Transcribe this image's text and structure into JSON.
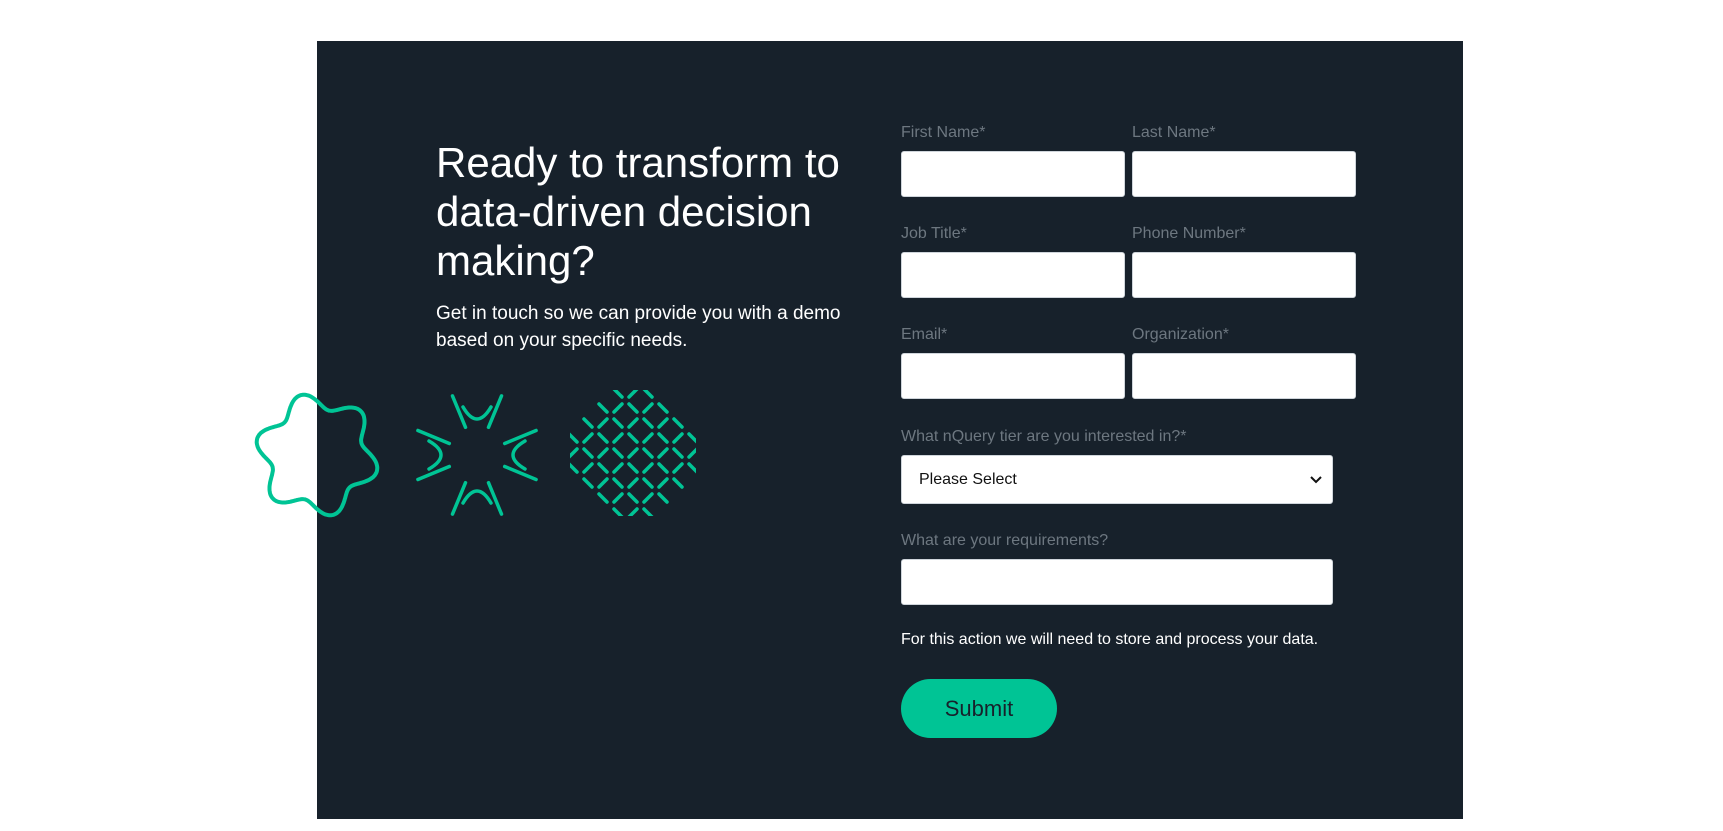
{
  "hero": {
    "title": "Ready to transform to data-driven decision making?",
    "subtitle": "Get in touch so we can provide you with a demo based on your specific needs."
  },
  "decorations": [
    "wavy-ring-icon",
    "radial-burst-icon",
    "dashed-pattern-icon"
  ],
  "form": {
    "first_name": {
      "label": "First Name*",
      "value": ""
    },
    "last_name": {
      "label": "Last Name*",
      "value": ""
    },
    "job_title": {
      "label": "Job Title*",
      "value": ""
    },
    "phone_number": {
      "label": "Phone Number*",
      "value": ""
    },
    "email": {
      "label": "Email*",
      "value": ""
    },
    "organization": {
      "label": "Organization*",
      "value": ""
    },
    "tier": {
      "label": "What nQuery tier are you interested in?*",
      "selected": "Please Select"
    },
    "requirements": {
      "label": "What are your requirements?",
      "value": ""
    },
    "notice": "For this action we will need to store and process your data.",
    "submit_label": "Submit"
  },
  "colors": {
    "panel_background": "#17212b",
    "accent": "#00c495",
    "label": "#6d7780",
    "text": "#ffffff"
  }
}
